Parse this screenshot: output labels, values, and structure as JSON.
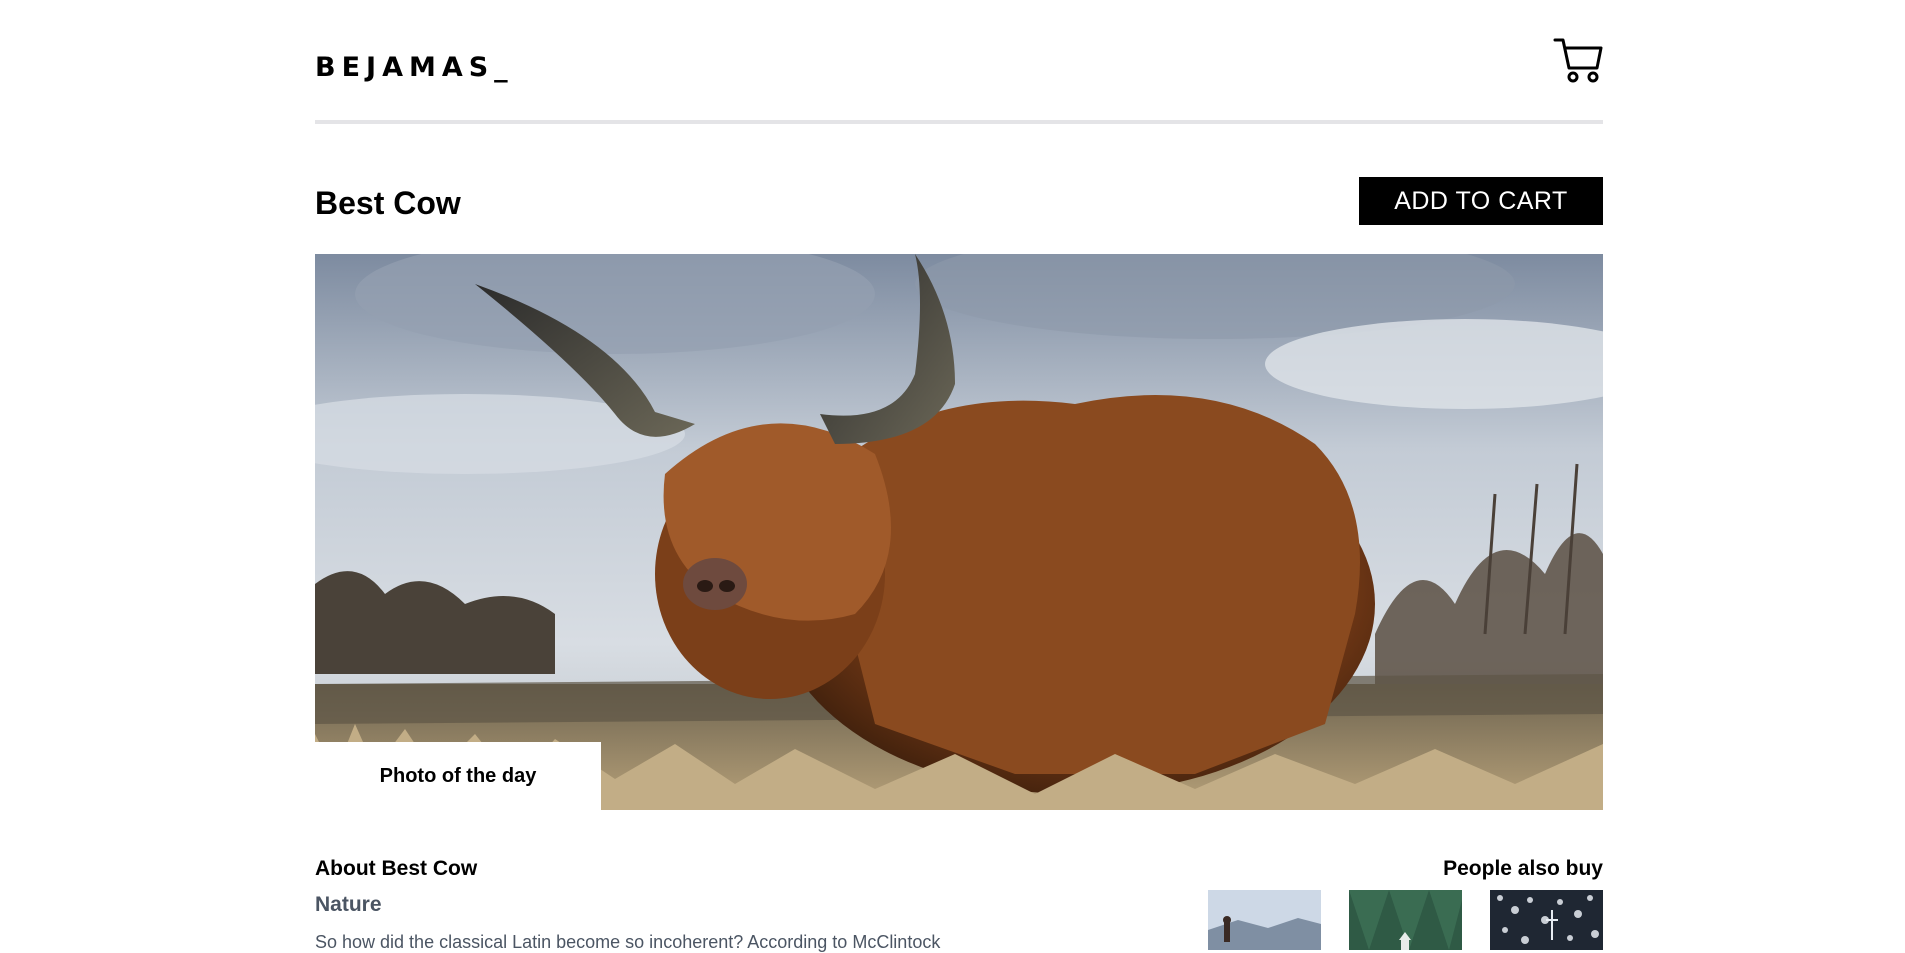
{
  "header": {
    "logo": "BEJAMAS_",
    "cart_icon": "shopping-cart-icon"
  },
  "product": {
    "title": "Best Cow",
    "add_to_cart_label": "ADD TO CART",
    "badge": "Photo of the day",
    "about_title": "About Best Cow",
    "category": "Nature",
    "description": "So how did the classical Latin become so incoherent? According to McClintock"
  },
  "also_buy": {
    "title": "People also buy",
    "items": [
      {
        "icon": "mountain-person-thumbnail"
      },
      {
        "icon": "forest-house-thumbnail"
      },
      {
        "icon": "snow-forest-thumbnail"
      }
    ]
  },
  "colors": {
    "button_bg": "#000000",
    "button_text": "#ffffff",
    "divider": "#e4e4e7",
    "muted_text": "#4b5563"
  }
}
